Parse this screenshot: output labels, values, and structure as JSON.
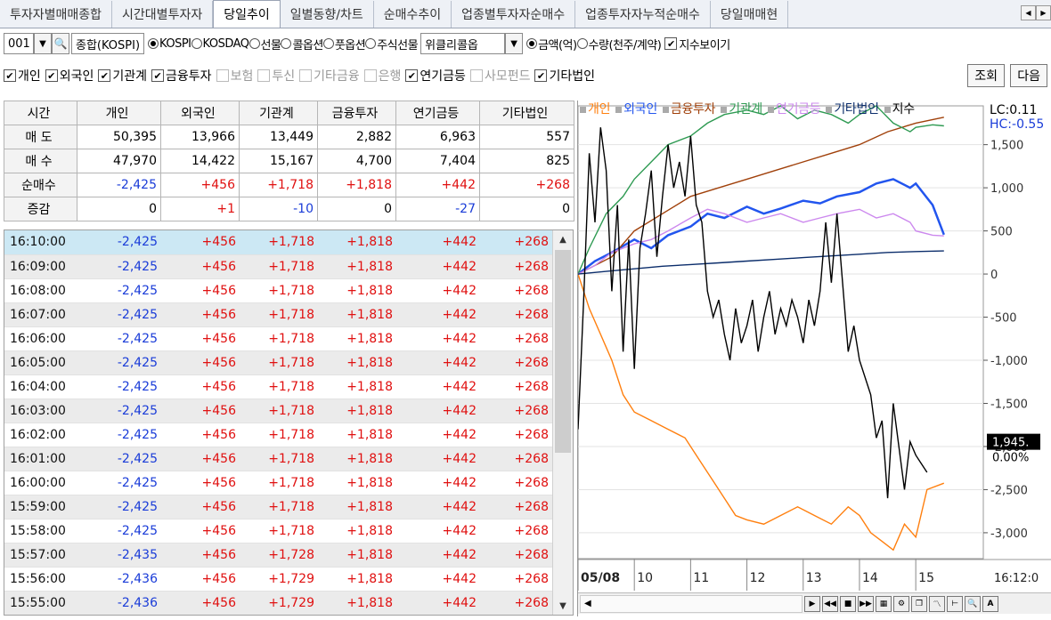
{
  "tabs": [
    {
      "label": "투자자별매매종합",
      "active": false
    },
    {
      "label": "시간대별투자자",
      "active": false
    },
    {
      "label": "당일추이",
      "active": true
    },
    {
      "label": "일별동향/차트",
      "active": false
    },
    {
      "label": "순매수추이",
      "active": false
    },
    {
      "label": "업종별투자자순매수",
      "active": false
    },
    {
      "label": "업종투자자누적순매수",
      "active": false
    },
    {
      "label": "당일매매현",
      "active": false
    }
  ],
  "toolbar": {
    "code": "001",
    "market_name": "종합(KOSPI)",
    "markets": [
      {
        "label": "KOSPI",
        "on": true
      },
      {
        "label": "KOSDAQ",
        "on": false
      },
      {
        "label": "선물",
        "on": false
      },
      {
        "label": "콜옵션",
        "on": false
      },
      {
        "label": "풋옵션",
        "on": false
      },
      {
        "label": "주식선물",
        "on": false
      }
    ],
    "weekly_select": "위클리콜옵",
    "units": [
      {
        "label": "금액(억)",
        "on": true
      },
      {
        "label": "수량(천주/계약)",
        "on": false
      }
    ],
    "show_index_label": "지수보이기"
  },
  "filters": [
    {
      "label": "개인",
      "checked": true,
      "enabled": true
    },
    {
      "label": "외국인",
      "checked": true,
      "enabled": true
    },
    {
      "label": "기관계",
      "checked": true,
      "enabled": true
    },
    {
      "label": "금융투자",
      "checked": true,
      "enabled": true
    },
    {
      "label": "보험",
      "checked": false,
      "enabled": false
    },
    {
      "label": "투신",
      "checked": false,
      "enabled": false
    },
    {
      "label": "기타금융",
      "checked": false,
      "enabled": false
    },
    {
      "label": "은행",
      "checked": false,
      "enabled": false
    },
    {
      "label": "연기금등",
      "checked": true,
      "enabled": true
    },
    {
      "label": "사모펀드",
      "checked": false,
      "enabled": false
    },
    {
      "label": "기타법인",
      "checked": true,
      "enabled": true
    }
  ],
  "buttons": {
    "query": "조회",
    "next": "다음"
  },
  "summary": {
    "headers": [
      "시간",
      "개인",
      "외국인",
      "기관계",
      "금융투자",
      "연기금등",
      "기타법인"
    ],
    "rows": [
      {
        "label": "매 도",
        "values": [
          "50,395",
          "13,966",
          "13,449",
          "2,882",
          "6,963",
          "557"
        ],
        "colors": [
          "",
          "",
          "",
          "",
          "",
          ""
        ]
      },
      {
        "label": "매 수",
        "values": [
          "47,970",
          "14,422",
          "15,167",
          "4,700",
          "7,404",
          "825"
        ],
        "colors": [
          "",
          "",
          "",
          "",
          "",
          ""
        ]
      },
      {
        "label": "순매수",
        "values": [
          "-2,425",
          "+456",
          "+1,718",
          "+1,818",
          "+442",
          "+268"
        ],
        "colors": [
          "#1a3cd8",
          "#e01010",
          "#e01010",
          "#e01010",
          "#e01010",
          "#e01010"
        ]
      },
      {
        "label": "증감",
        "values": [
          "0",
          "+1",
          "-10",
          "0",
          "-27",
          "0"
        ],
        "colors": [
          "",
          "#e01010",
          "#1a3cd8",
          "",
          "#1a3cd8",
          ""
        ]
      }
    ]
  },
  "time_rows": [
    [
      "16:10:00",
      "-2,425",
      "+456",
      "+1,718",
      "+1,818",
      "+442",
      "+268"
    ],
    [
      "16:09:00",
      "-2,425",
      "+456",
      "+1,718",
      "+1,818",
      "+442",
      "+268"
    ],
    [
      "16:08:00",
      "-2,425",
      "+456",
      "+1,718",
      "+1,818",
      "+442",
      "+268"
    ],
    [
      "16:07:00",
      "-2,425",
      "+456",
      "+1,718",
      "+1,818",
      "+442",
      "+268"
    ],
    [
      "16:06:00",
      "-2,425",
      "+456",
      "+1,718",
      "+1,818",
      "+442",
      "+268"
    ],
    [
      "16:05:00",
      "-2,425",
      "+456",
      "+1,718",
      "+1,818",
      "+442",
      "+268"
    ],
    [
      "16:04:00",
      "-2,425",
      "+456",
      "+1,718",
      "+1,818",
      "+442",
      "+268"
    ],
    [
      "16:03:00",
      "-2,425",
      "+456",
      "+1,718",
      "+1,818",
      "+442",
      "+268"
    ],
    [
      "16:02:00",
      "-2,425",
      "+456",
      "+1,718",
      "+1,818",
      "+442",
      "+268"
    ],
    [
      "16:01:00",
      "-2,425",
      "+456",
      "+1,718",
      "+1,818",
      "+442",
      "+268"
    ],
    [
      "16:00:00",
      "-2,425",
      "+456",
      "+1,718",
      "+1,818",
      "+442",
      "+268"
    ],
    [
      "15:59:00",
      "-2,425",
      "+456",
      "+1,718",
      "+1,818",
      "+442",
      "+268"
    ],
    [
      "15:58:00",
      "-2,425",
      "+456",
      "+1,718",
      "+1,818",
      "+442",
      "+268"
    ],
    [
      "15:57:00",
      "-2,435",
      "+456",
      "+1,728",
      "+1,818",
      "+442",
      "+268"
    ],
    [
      "15:56:00",
      "-2,436",
      "+456",
      "+1,729",
      "+1,818",
      "+442",
      "+268"
    ],
    [
      "15:55:00",
      "-2,436",
      "+456",
      "+1,729",
      "+1,818",
      "+442",
      "+268"
    ]
  ],
  "colors": {
    "blue": "#1a3cd8",
    "red": "#e01010",
    "selected_row": "#cce8f4"
  },
  "chart_data": {
    "type": "line",
    "legend": [
      {
        "name": "개인",
        "color": "#ff7f0e"
      },
      {
        "name": "외국인",
        "color": "#2255ee"
      },
      {
        "name": "금융투자",
        "color": "#a0400a"
      },
      {
        "name": "기관계",
        "color": "#2e9a52"
      },
      {
        "name": "연기금등",
        "color": "#cc88ee"
      },
      {
        "name": "기타법인",
        "color": "#0b2d6b"
      },
      {
        "name": "지수",
        "color": "#000000"
      }
    ],
    "lc": "LC:0.11",
    "hc": "HC:-0.55",
    "y_ticks": [
      1500,
      1000,
      500,
      0,
      -500,
      -1000,
      -1500,
      -2000,
      -2500,
      -3000
    ],
    "y_tick_labels": [
      "1,500",
      "1,000",
      "500",
      "0",
      "-500",
      "-1,000",
      "-1,500",
      "-2,000",
      "-2,500",
      "-3,000"
    ],
    "ylim": [
      -3300,
      1950
    ],
    "x_ticks": [
      "05/08",
      "10",
      "11",
      "12",
      "13",
      "14",
      "15"
    ],
    "x_tick_hours": [
      9,
      10,
      11,
      12,
      13,
      14,
      15
    ],
    "x_range": [
      9,
      16.2
    ],
    "right_label": "16:12:0",
    "current_index_label": "1,945.",
    "current_pct_label": "0.00%",
    "series": [
      {
        "name": "개인",
        "x": [
          9,
          9.2,
          9.4,
          9.6,
          9.8,
          10,
          10.3,
          10.6,
          10.9,
          11,
          11.2,
          11.4,
          11.6,
          11.8,
          12,
          12.3,
          12.6,
          12.9,
          13.2,
          13.5,
          13.8,
          14,
          14.2,
          14.4,
          14.6,
          14.8,
          15,
          15.2,
          15.5
        ],
        "y": [
          0,
          -400,
          -700,
          -1000,
          -1400,
          -1600,
          -1700,
          -1800,
          -1900,
          -2000,
          -2200,
          -2400,
          -2600,
          -2800,
          -2850,
          -2900,
          -2800,
          -2700,
          -2800,
          -2900,
          -2700,
          -2800,
          -3000,
          -3100,
          -3200,
          -2900,
          -3050,
          -2500,
          -2425
        ]
      },
      {
        "name": "외국인",
        "x": [
          9,
          9.3,
          9.6,
          10,
          10.3,
          10.6,
          11,
          11.3,
          11.6,
          12,
          12.3,
          12.6,
          13,
          13.3,
          13.6,
          14,
          14.3,
          14.6,
          14.9,
          15,
          15.3,
          15.5
        ],
        "y": [
          0,
          150,
          250,
          400,
          300,
          450,
          550,
          700,
          650,
          780,
          700,
          760,
          850,
          820,
          900,
          950,
          1050,
          1100,
          1000,
          1050,
          800,
          456
        ]
      },
      {
        "name": "금융투자",
        "x": [
          9,
          9.3,
          9.6,
          10,
          10.5,
          11,
          11.5,
          12,
          12.5,
          13,
          13.5,
          14,
          14.5,
          15,
          15.5
        ],
        "y": [
          0,
          100,
          200,
          500,
          700,
          900,
          1000,
          1100,
          1200,
          1300,
          1400,
          1500,
          1650,
          1750,
          1818
        ]
      },
      {
        "name": "기관계",
        "x": [
          9,
          9.2,
          9.5,
          9.8,
          10,
          10.3,
          10.6,
          11,
          11.3,
          11.6,
          12,
          12.3,
          12.6,
          12.9,
          13.2,
          13.5,
          13.8,
          14,
          14.3,
          14.6,
          14.9,
          15,
          15.3,
          15.5
        ],
        "y": [
          0,
          300,
          700,
          900,
          1100,
          1300,
          1500,
          1600,
          1750,
          1850,
          1900,
          1850,
          1950,
          1800,
          1900,
          1850,
          1750,
          1850,
          1950,
          1750,
          1650,
          1700,
          1730,
          1718
        ]
      },
      {
        "name": "연기금등",
        "x": [
          9,
          9.3,
          9.6,
          10,
          10.3,
          10.6,
          11,
          11.3,
          11.6,
          12,
          12.3,
          12.6,
          13,
          13.3,
          13.6,
          14,
          14.3,
          14.6,
          14.9,
          15,
          15.3,
          15.5
        ],
        "y": [
          0,
          100,
          250,
          350,
          400,
          500,
          650,
          750,
          700,
          600,
          650,
          700,
          600,
          650,
          700,
          750,
          650,
          700,
          600,
          500,
          450,
          442
        ]
      },
      {
        "name": "기타법인",
        "x": [
          9,
          9.5,
          10,
          10.5,
          11,
          11.5,
          12,
          12.5,
          13,
          13.5,
          14,
          14.5,
          15,
          15.5
        ],
        "y": [
          0,
          30,
          60,
          90,
          110,
          130,
          150,
          170,
          190,
          210,
          230,
          250,
          260,
          268
        ]
      },
      {
        "name": "지수",
        "x": [
          9,
          9.1,
          9.2,
          9.3,
          9.4,
          9.5,
          9.6,
          9.7,
          9.8,
          9.9,
          10,
          10.1,
          10.2,
          10.3,
          10.4,
          10.5,
          10.6,
          10.7,
          10.8,
          10.9,
          11,
          11.1,
          11.2,
          11.3,
          11.4,
          11.5,
          11.6,
          11.7,
          11.8,
          11.9,
          12,
          12.1,
          12.2,
          12.3,
          12.4,
          12.5,
          12.6,
          12.7,
          12.8,
          12.9,
          13,
          13.1,
          13.2,
          13.3,
          13.4,
          13.5,
          13.6,
          13.7,
          13.8,
          13.9,
          14,
          14.1,
          14.2,
          14.3,
          14.4,
          14.5,
          14.6,
          14.7,
          14.8,
          14.9,
          15,
          15.1,
          15.2
        ],
        "y": [
          -1800,
          -300,
          1400,
          600,
          1700,
          1200,
          -200,
          800,
          -900,
          400,
          -1100,
          300,
          700,
          1200,
          200,
          900,
          1500,
          1000,
          1300,
          900,
          1600,
          800,
          600,
          -200,
          -500,
          -300,
          -700,
          -1000,
          -400,
          -800,
          -600,
          -300,
          -900,
          -500,
          -200,
          -700,
          -400,
          -600,
          -300,
          -500,
          -800,
          -300,
          -600,
          -200,
          600,
          -100,
          700,
          -100,
          -900,
          -600,
          -1000,
          -1200,
          -1400,
          -1900,
          -1700,
          -2600,
          -1500,
          -2000,
          -2500,
          -1945,
          -2100,
          -2200,
          -2300
        ]
      }
    ]
  }
}
